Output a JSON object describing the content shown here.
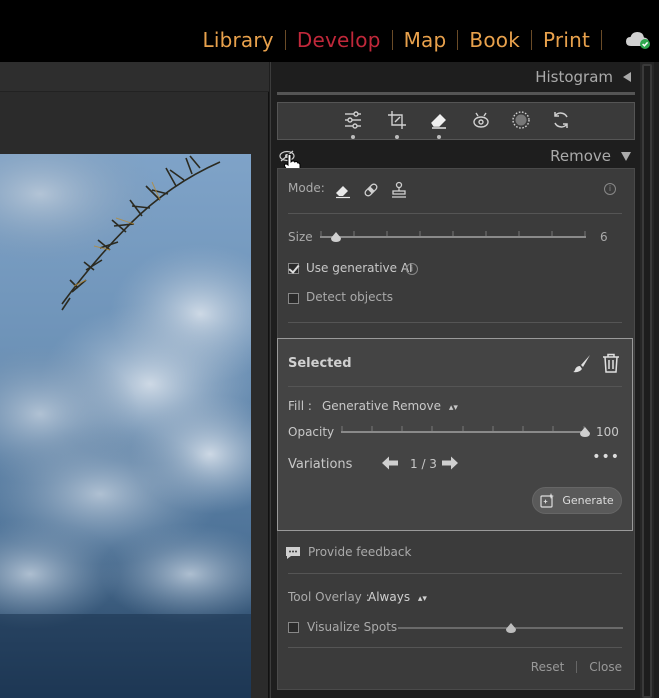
{
  "top_bar": {
    "modules": [
      {
        "label": "Library",
        "active": false
      },
      {
        "label": "Develop",
        "active": true
      },
      {
        "label": "Map",
        "active": false
      },
      {
        "label": "Book",
        "active": false
      },
      {
        "label": "Print",
        "active": false
      }
    ],
    "sync_icon": "cloud-sync-icon"
  },
  "histogram_panel": {
    "title": "Histogram"
  },
  "tool_strip": {
    "tools": [
      "edit-sliders-icon",
      "crop-icon",
      "remove-eraser-icon",
      "red-eye-icon",
      "masking-icon",
      "presets-icon"
    ]
  },
  "remove_panel": {
    "title": "Remove",
    "mode_label": "Mode:",
    "mode_icons": [
      "eraser-icon",
      "heal-bandage-icon",
      "clone-stamp-icon"
    ],
    "size_label": "Size",
    "size_value": "6",
    "size_level": 0.06,
    "use_generative_ai_label": "Use generative AI",
    "use_generative_ai_checked": true,
    "detect_objects_label": "Detect objects",
    "detect_objects_checked": false,
    "selected": {
      "title": "Selected",
      "fill_label": "Fill :",
      "fill_value": "Generative Remove",
      "opacity_label": "Opacity",
      "opacity_value": "100",
      "opacity_level": 1.0,
      "variations_label": "Variations",
      "variations_counter": "1 / 3",
      "generate_label": "Generate"
    },
    "feedback_label": "Provide feedback",
    "tool_overlay_label": "Tool Overlay :",
    "tool_overlay_value": "Always",
    "visualize_spots_label": "Visualize Spots",
    "visualize_spots_checked": false,
    "visualize_spots_level": 0.5,
    "reset_label": "Reset",
    "close_label": "Close"
  },
  "colors": {
    "module_active": "#c0283a",
    "module_inactive": "#e8a14c",
    "panel_bg": "#3b3b3b",
    "selected_bg": "#444444"
  }
}
